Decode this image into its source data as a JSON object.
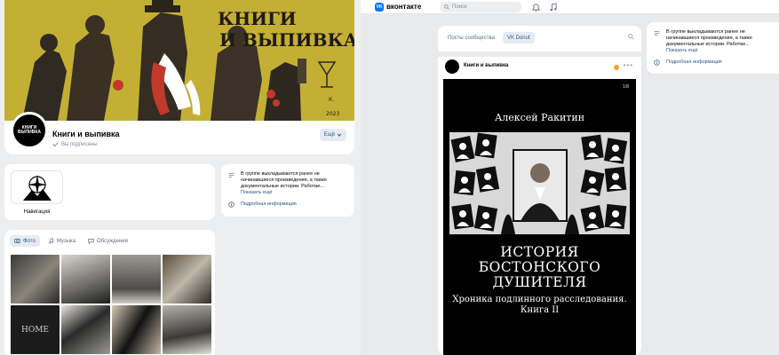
{
  "cover": {
    "title_line1": "КНИГИ",
    "title_line2": "И ВЫПИВКА",
    "artist_sign": "К.",
    "year": "2023",
    "colors": {
      "background": "#c9b43a",
      "figure_dark": "#3a2f24",
      "accent_red": "#c0392b"
    }
  },
  "profile": {
    "avatar_text": "КНИГИ ВЫПИВКА",
    "name": "Книги и выпивка",
    "subscribed": "Вы подписаны",
    "more_label": "Ещё"
  },
  "navigation": {
    "label": "Навигация"
  },
  "info": {
    "description_line1": "В группе выкладываются ранее не",
    "description_line2": "начинавшиеся произведения, а также",
    "description_line3": "документальные истории. Работае...",
    "show_more": "Показать ещё",
    "details": "Подробная информация"
  },
  "media_tabs": [
    {
      "label": "Фото",
      "icon": "photo-icon",
      "active": true
    },
    {
      "label": "Музыка",
      "icon": "music-icon",
      "active": false
    },
    {
      "label": "Обсуждения",
      "icon": "discussion-icon",
      "active": false
    }
  ],
  "photo_grid": {
    "home_text": "HOME"
  },
  "topbar": {
    "logo_text": "VK",
    "brand": "вконтакте",
    "search_placeholder": "Поиск",
    "accent": "#0077ff"
  },
  "wall": {
    "tabs": [
      {
        "label": "Посты сообщества",
        "active": false
      },
      {
        "label": "VK Donut",
        "active": true
      }
    ]
  },
  "post": {
    "author": "Книги и выпивка",
    "counter": "1/8",
    "book_author": "Алексей Ракитин",
    "book_title_line1": "ИСТОРИЯ",
    "book_title_line2": "БОСТОНСКОГО",
    "book_title_line3": "ДУШИТЕЛЯ",
    "book_subtitle_line1": "Хроника подлинного расследования.",
    "book_subtitle_line2": "Книга II"
  }
}
